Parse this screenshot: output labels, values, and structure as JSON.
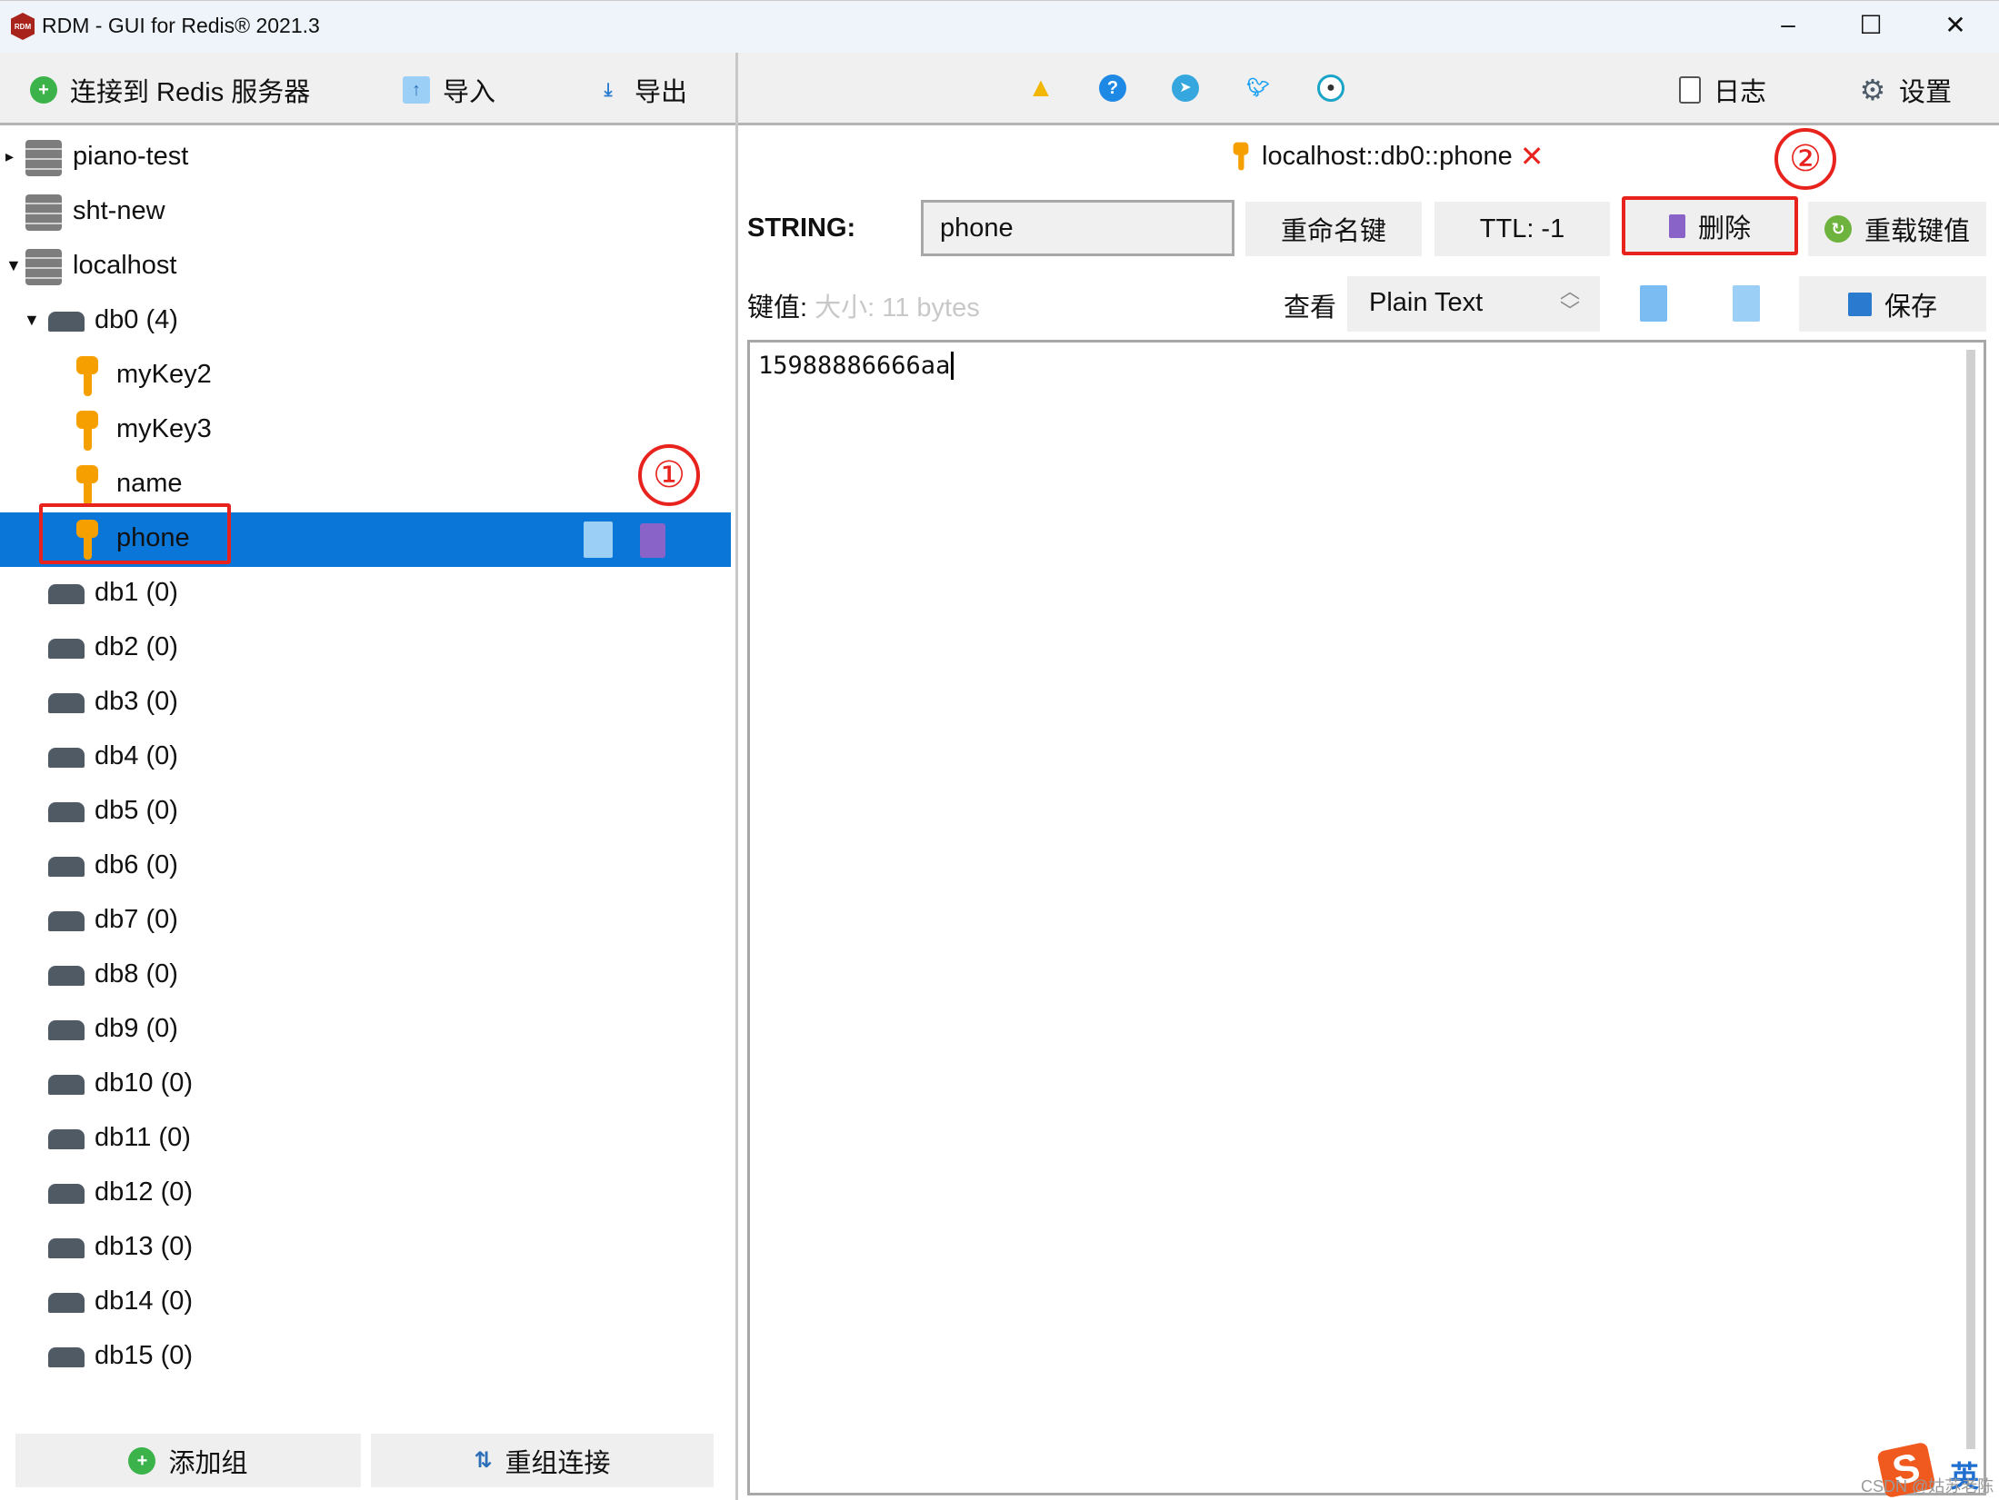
{
  "window": {
    "title": "RDM - GUI for Redis® 2021.3",
    "logo_text": "RDM",
    "controls": [
      "–",
      "☐",
      "✕"
    ]
  },
  "toolbar": {
    "connect": "连接到 Redis 服务器",
    "import": "导入",
    "export": "导出",
    "log": "日志",
    "settings": "设置",
    "icons": [
      "warning-icon",
      "help-icon",
      "telegram-icon",
      "twitter-icon",
      "github-icon"
    ]
  },
  "tree": [
    {
      "type": "server",
      "label": "piano-test",
      "expand": "▸"
    },
    {
      "type": "server",
      "label": "sht-new",
      "expand": ""
    },
    {
      "type": "server",
      "label": "localhost",
      "expand": "▼"
    },
    {
      "type": "db",
      "label": "db0  (4)",
      "expand": "▼"
    },
    {
      "type": "key",
      "label": "myKey2"
    },
    {
      "type": "key",
      "label": "myKey3"
    },
    {
      "type": "key",
      "label": "name"
    },
    {
      "type": "key",
      "label": "phone",
      "selected": true
    },
    {
      "type": "db",
      "label": "db1  (0)"
    },
    {
      "type": "db",
      "label": "db2  (0)"
    },
    {
      "type": "db",
      "label": "db3  (0)"
    },
    {
      "type": "db",
      "label": "db4  (0)"
    },
    {
      "type": "db",
      "label": "db5  (0)"
    },
    {
      "type": "db",
      "label": "db6  (0)"
    },
    {
      "type": "db",
      "label": "db7  (0)"
    },
    {
      "type": "db",
      "label": "db8  (0)"
    },
    {
      "type": "db",
      "label": "db9  (0)"
    },
    {
      "type": "db",
      "label": "db10  (0)"
    },
    {
      "type": "db",
      "label": "db11  (0)"
    },
    {
      "type": "db",
      "label": "db12  (0)"
    },
    {
      "type": "db",
      "label": "db13  (0)"
    },
    {
      "type": "db",
      "label": "db14  (0)"
    },
    {
      "type": "db",
      "label": "db15  (0)"
    }
  ],
  "sidebar_footer": {
    "add_group": "添加组",
    "reconnect": "重组连接"
  },
  "tab": {
    "title": "localhost::db0::phone",
    "close": "✕"
  },
  "key_editor": {
    "type_label": "STRING:",
    "key_name": "phone",
    "rename": "重命名键",
    "ttl": "TTL:  -1",
    "delete": "删除",
    "reload": "重载键值",
    "value_label": "键值:",
    "size": "大小:  11 bytes",
    "view_label": "查看",
    "view_mode": "Plain Text",
    "save": "保存",
    "value": "15988886666aa"
  },
  "annotations": {
    "one": "①",
    "two": "②"
  },
  "watermark": "CSDN @姑苏老陈",
  "ime": "英",
  "colors": {
    "selection": "#0a76d8",
    "annotation": "#e8231d",
    "key": "#f5a000"
  }
}
